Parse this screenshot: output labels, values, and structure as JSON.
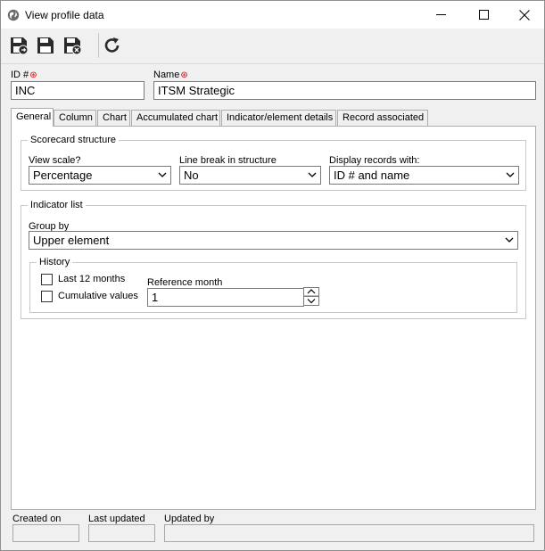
{
  "window": {
    "title": "View profile data"
  },
  "toolbar": {
    "buttons": [
      {
        "name": "save-and-new",
        "icon": "floppy-plus-icon"
      },
      {
        "name": "save",
        "icon": "floppy-icon"
      },
      {
        "name": "save-and-close",
        "icon": "floppy-close-icon"
      },
      {
        "name": "refresh",
        "icon": "refresh-icon"
      }
    ]
  },
  "header": {
    "id_label": "ID #",
    "id_value": "INC",
    "name_label": "Name",
    "name_value": "ITSM Strategic"
  },
  "tabs": [
    {
      "label": "General",
      "active": true
    },
    {
      "label": "Column",
      "active": false
    },
    {
      "label": "Chart",
      "active": false
    },
    {
      "label": "Accumulated chart",
      "active": false
    },
    {
      "label": "Indicator/element details",
      "active": false
    },
    {
      "label": "Record associated",
      "active": false
    }
  ],
  "general": {
    "scorecard": {
      "legend": "Scorecard structure",
      "view_scale_label": "View scale?",
      "view_scale_value": "Percentage",
      "line_break_label": "Line break in structure",
      "line_break_value": "No",
      "display_records_label": "Display records with:",
      "display_records_value": "ID # and name"
    },
    "indicator_list": {
      "legend": "Indicator list",
      "group_by_label": "Group by",
      "group_by_value": "Upper element",
      "history": {
        "legend": "History",
        "last12_label": "Last 12 months",
        "last12_checked": false,
        "cumulative_label": "Cumulative values",
        "cumulative_checked": false,
        "reference_month_label": "Reference month",
        "reference_month_value": "1"
      }
    }
  },
  "footer": {
    "created_on_label": "Created on",
    "created_on_value": "",
    "last_updated_label": "Last updated",
    "last_updated_value": "",
    "updated_by_label": "Updated by",
    "updated_by_value": ""
  },
  "colors": {
    "window_bg": "#f0f0f0",
    "required_marker": "#d40000",
    "toolbar_icon": "#2b2b2b"
  }
}
